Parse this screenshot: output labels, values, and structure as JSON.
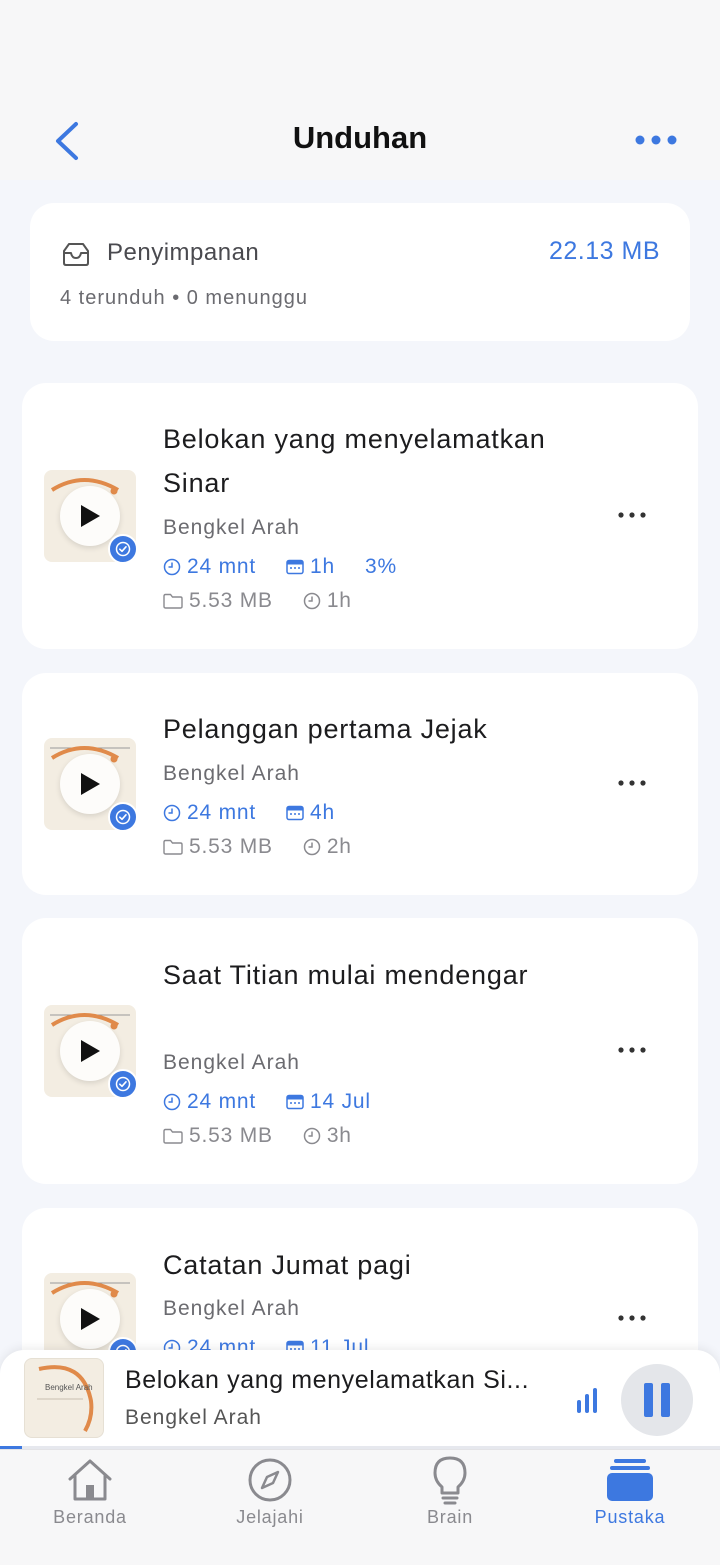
{
  "header": {
    "title": "Unduhan"
  },
  "storage": {
    "label": "Penyimpanan",
    "size": "22.13 MB",
    "summary": "4 terunduh • 0 menunggu"
  },
  "episodes": [
    {
      "title": "Belokan yang menyelamatkan Sinar",
      "author": "Bengkel Arah",
      "duration": "24 mnt",
      "date": "1h",
      "progress": "3%",
      "file_size": "5.53 MB",
      "downloaded": "1h"
    },
    {
      "title": "Pelanggan pertama Jejak",
      "author": "Bengkel Arah",
      "duration": "24 mnt",
      "date": "4h",
      "file_size": "5.53 MB",
      "downloaded": "2h"
    },
    {
      "title": "Saat Titian mulai mendengar",
      "author": "Bengkel Arah",
      "duration": "24 mnt",
      "date": "14 Jul",
      "file_size": "5.53 MB",
      "downloaded": "3h"
    },
    {
      "title": "Catatan Jumat pagi",
      "author": "Bengkel Arah",
      "duration": "24 mnt",
      "date": "11 Jul"
    }
  ],
  "player": {
    "title": "Belokan yang menyelamatkan Si...",
    "author": "Bengkel Arah",
    "thumb_text": "Bengkel Arah",
    "progress_fraction": 0.03
  },
  "tabs": [
    {
      "label": "Beranda",
      "icon": "home-icon"
    },
    {
      "label": "Jelajahi",
      "icon": "compass-icon"
    },
    {
      "label": "Brain",
      "icon": "lightbulb-icon"
    },
    {
      "label": "Pustaka",
      "icon": "library-icon",
      "active": true
    }
  ],
  "colors": {
    "accent": "#3d78e0",
    "background": "#f4f6fb",
    "card": "#ffffff"
  }
}
